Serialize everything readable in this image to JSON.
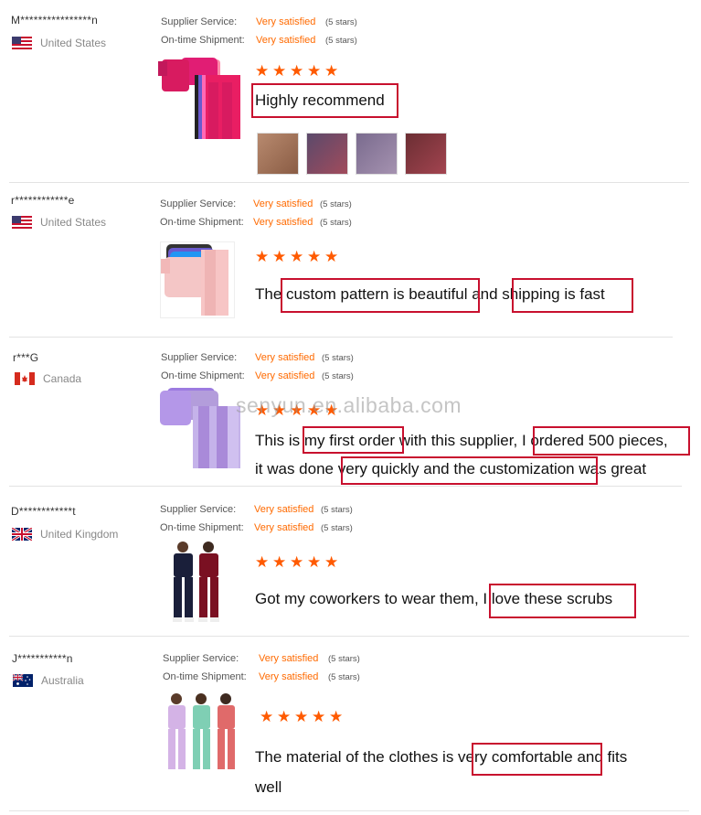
{
  "reviews": [
    {
      "user": "M****************n",
      "country": "United States",
      "flag": "us-flag",
      "supplier_label": "Supplier Service:",
      "supplier_value": "Very satisfied",
      "supplier_stars": "(5 stars)",
      "shipment_label": "On-time Shipment:",
      "shipment_value": "Very satisfied",
      "shipment_stars": "(5 stars)",
      "comment": "Highly recommend",
      "image": "pink-scrub-set-stack"
    },
    {
      "user": "r************e",
      "country": "United States",
      "flag": "us-flag",
      "supplier_label": "Supplier Service:",
      "supplier_value": "Very satisfied",
      "supplier_stars": "(5 stars)",
      "shipment_label": "On-time Shipment:",
      "shipment_value": "Very satisfied",
      "shipment_stars": "(5 stars)",
      "comment_parts": [
        "The ",
        "custom pattern is beautiful",
        " and ",
        "shipping is fast"
      ],
      "image": "light-pink-scrub-set"
    },
    {
      "user": "r***G",
      "country": "Canada",
      "flag": "canada-flag",
      "supplier_label": "Supplier Service:",
      "supplier_value": "Very satisfied",
      "supplier_stars": "(5 stars)",
      "shipment_label": "On-time Shipment:",
      "shipment_value": "Very satisfied",
      "shipment_stars": "(5 stars)",
      "comment_line1_parts": [
        "This is ",
        "my first order",
        " with this supplier, ",
        "I ordered 500 pieces,"
      ],
      "comment_line2_parts": [
        " it was done ",
        "very quickly and the customization",
        " was great"
      ],
      "image": "lavender-scrub-set"
    },
    {
      "user": "D************t",
      "country": "United Kingdom",
      "flag": "uk-flag",
      "supplier_label": "Supplier Service:",
      "supplier_value": "Very satisfied",
      "supplier_stars": "(5 stars)",
      "shipment_label": "On-time Shipment:",
      "shipment_value": "Very satisfied",
      "shipment_stars": "(5 stars)",
      "comment_parts": [
        "Got my coworkers to wear them, ",
        "I love these scrubs"
      ],
      "image": "two-models-scrubs"
    },
    {
      "user": "J***********n",
      "country": "Australia",
      "flag": "australia-flag",
      "supplier_label": "Supplier Service:",
      "supplier_value": "Very satisfied",
      "supplier_stars": "(5 stars)",
      "shipment_label": "On-time Shipment:",
      "shipment_value": "Very satisfied",
      "shipment_stars": "(5 stars)",
      "comment_line1_parts": [
        "The material of the clothes is ",
        "very comfortable",
        " and fits"
      ],
      "comment_line2": "well",
      "image": "three-models-scrubs"
    }
  ],
  "watermark": "senyun.en.alibaba.com",
  "colors": {
    "accent": "#ff6a00",
    "star": "#ff5a00",
    "highlight": "#c8102e"
  }
}
